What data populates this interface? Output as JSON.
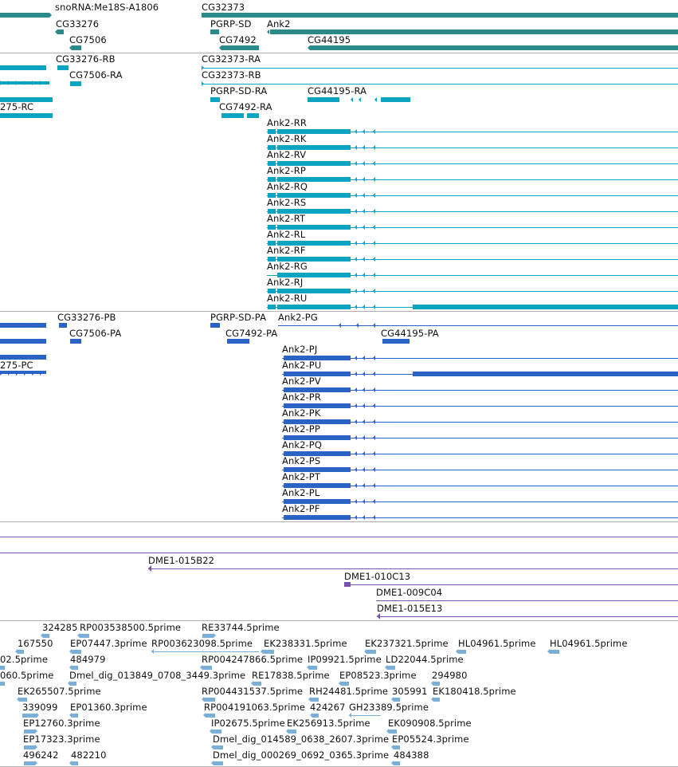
{
  "colors": {
    "gene": "#2a8a8a",
    "transcript": "#0aa3c0",
    "protein": "#2b63c4",
    "clone": "#7a52b0",
    "est": "#7ab0d8",
    "separator": "#b0b0b0"
  },
  "gene_track": {
    "labels": [
      "snoRNA:Me18S-A1806",
      "CG32373",
      "CG33276",
      "PGRP-SD",
      "Ank2",
      "CG7506",
      "CG7492",
      "CG44195"
    ]
  },
  "transcript_track": {
    "labels": [
      "CG33276-RB",
      "CG32373-RA",
      "CG7506-RA",
      "CG32373-RB",
      "PGRP-SD-RA",
      "CG44195-RA",
      "275-RC",
      "CG7492-RA",
      "Ank2-RR",
      "Ank2-RK",
      "Ank2-RV",
      "Ank2-RP",
      "Ank2-RQ",
      "Ank2-RS",
      "Ank2-RT",
      "Ank2-RL",
      "Ank2-RF",
      "Ank2-RG",
      "Ank2-RJ",
      "Ank2-RU"
    ]
  },
  "protein_track": {
    "labels": [
      "CG33276-PB",
      "PGRP-SD-PA",
      "Ank2-PG",
      "CG7506-PA",
      "CG7492-PA",
      "CG44195-PA",
      "275-PC",
      "Ank2-PJ",
      "Ank2-PU",
      "Ank2-PV",
      "Ank2-PR",
      "Ank2-PK",
      "Ank2-PP",
      "Ank2-PQ",
      "Ank2-PS",
      "Ank2-PT",
      "Ank2-PL",
      "Ank2-PF"
    ]
  },
  "clone_track": {
    "labels": [
      "DME1-015B22",
      "DME1-010C13",
      "DME1-009C04",
      "DME1-015E13"
    ]
  },
  "est_track": {
    "labels": [
      "324285",
      "RP003538500.5prime",
      "RE33744.5prime",
      "167550",
      "EP07447.3prime",
      "RP003623098.5prime",
      "EK238331.5prime",
      "EK237321.5prime",
      "HL04961.5prime",
      "HL04961.5prime",
      "02.5prime",
      "484979",
      "RP004247866.5prime",
      "IP09921.5prime",
      "LD22044.5prime",
      "060.5prime",
      "Dmel_dig_013849_0708_3449.3prime",
      "RE17838.5prime",
      "EP08523.3prime",
      "294980",
      "EK265507.5prime",
      "RP004431537.5prime",
      "RH24481.5prime",
      "305991",
      "EK180418.5prime",
      "339099",
      "EP01360.3prime",
      "RP004191063.5prime",
      "424267",
      "GH23389.5prime",
      "EP12760.3prime",
      "IP02675.5prime",
      "EK256913.5prime",
      "EK090908.5prime",
      "EP17323.3prime",
      "Dmel_dig_014589_0638_2607.3prime",
      "EP05524.3prime",
      "496242",
      "482210",
      "Dmel_dig_000269_0692_0365.3prime",
      "484388"
    ]
  }
}
